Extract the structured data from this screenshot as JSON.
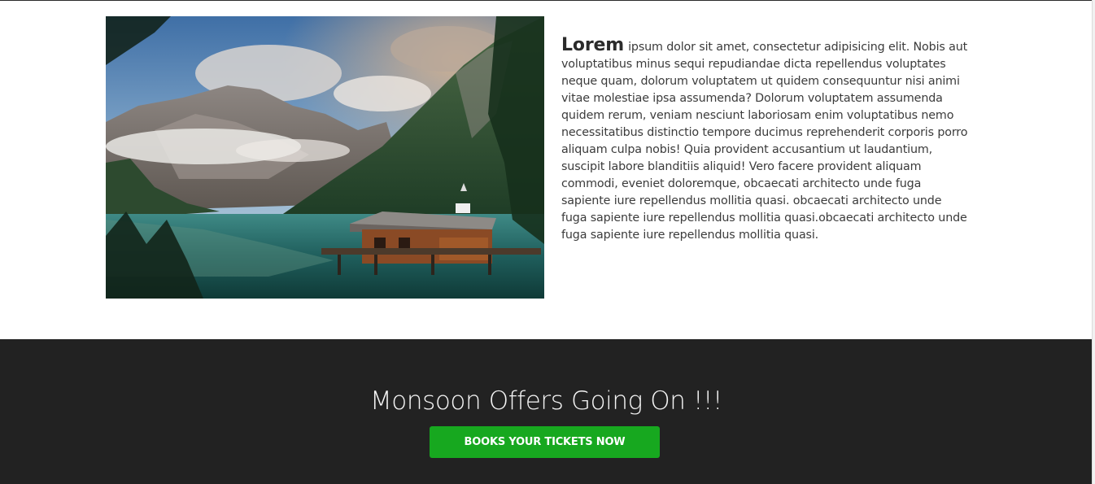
{
  "about": {
    "lead_word": "Lorem",
    "body_text": "ipsum dolor sit amet, consectetur adipisicing elit. Nobis aut voluptatibus minus sequi repudiandae dicta repellendus voluptates neque quam, dolorum voluptatem ut quidem consequuntur nisi animi vitae molestiae ipsa assumenda? Dolorum voluptatem assumenda quidem rerum, veniam nesciunt laboriosam enim voluptatibus nemo necessitatibus distinctio tempore ducimus reprehenderit corporis porro aliquam culpa nobis! Quia provident accusantium ut laudantium, suscipit labore blanditiis aliquid! Vero facere provident aliquam commodi, eveniet doloremque, obcaecati architecto unde fuga sapiente iure repellendus mollitia quasi. obcaecati architecto unde fuga sapiente iure repellendus mollitia quasi.obcaecati architecto unde fuga sapiente iure repellendus mollitia quasi.",
    "image_subject": "mountain-lake-boathouse-photo"
  },
  "offer": {
    "title": "Monsoon Offers Going On !!!",
    "button_label": "BOOKS YOUR TICKETS NOW",
    "button_color": "#17a81f",
    "background_color": "#222222"
  }
}
